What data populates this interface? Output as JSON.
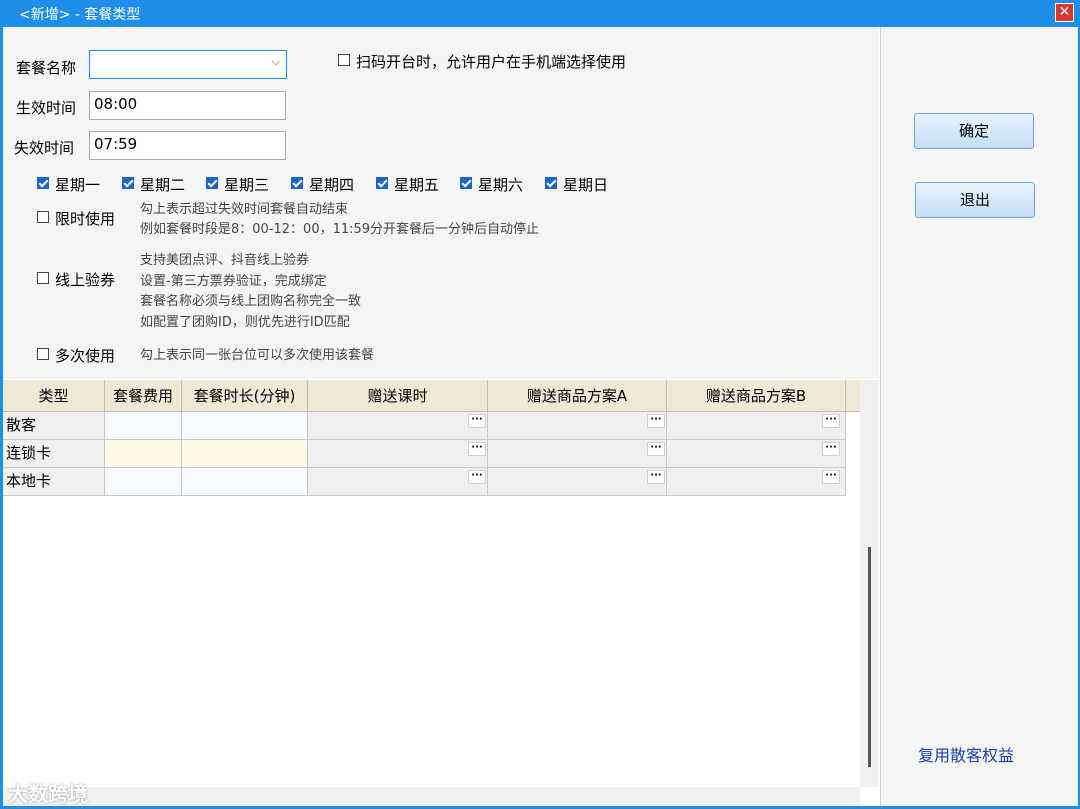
{
  "window": {
    "title": "<新增> - 套餐类型",
    "close_glyph": "✕"
  },
  "form": {
    "name_label": "套餐名称",
    "name_value": "",
    "scan_option_label": "扫码开台时，允许用户在手机端选择使用",
    "start_label": "生效时间",
    "start_value": "08:00",
    "end_label": "失效时间",
    "end_value": "07:59",
    "weekdays": [
      {
        "label": "星期一",
        "checked": true
      },
      {
        "label": "星期二",
        "checked": true
      },
      {
        "label": "星期三",
        "checked": true
      },
      {
        "label": "星期四",
        "checked": true
      },
      {
        "label": "星期五",
        "checked": true
      },
      {
        "label": "星期六",
        "checked": true
      },
      {
        "label": "星期日",
        "checked": true
      }
    ],
    "limit": {
      "label": "限时使用",
      "hint1": "勾上表示超过失效时间套餐自动结束",
      "hint2": "例如套餐时段是8：00-12：00，11:59分开套餐后一分钟后自动停止"
    },
    "online": {
      "label": "线上验券",
      "hint1": "支持美团点评、抖音线上验券",
      "hint2": "设置-第三方票券验证，完成绑定",
      "hint3": "套餐名称必须与线上团购名称完全一致",
      "hint4": "如配置了团购ID，则优先进行ID匹配"
    },
    "multi": {
      "label": "多次使用",
      "hint": "勾上表示同一张台位可以多次使用该套餐"
    }
  },
  "buttons": {
    "ok": "确定",
    "exit": "退出"
  },
  "link": "复用散客权益",
  "grid": {
    "headers": [
      "类型",
      "套餐费用",
      "套餐时长(分钟)",
      "赠送课时",
      "赠送商品方案A",
      "赠送商品方案B"
    ],
    "rows": [
      {
        "type": "散客"
      },
      {
        "type": "连锁卡"
      },
      {
        "type": "本地卡"
      }
    ],
    "ellipsis": "···"
  },
  "watermark": "大数跨境",
  "colors": {
    "titlebar": "#1f8ee8",
    "header_bg": "#efe8d4",
    "row_highlight": "#fff8e6",
    "link": "#1a3fb0"
  }
}
